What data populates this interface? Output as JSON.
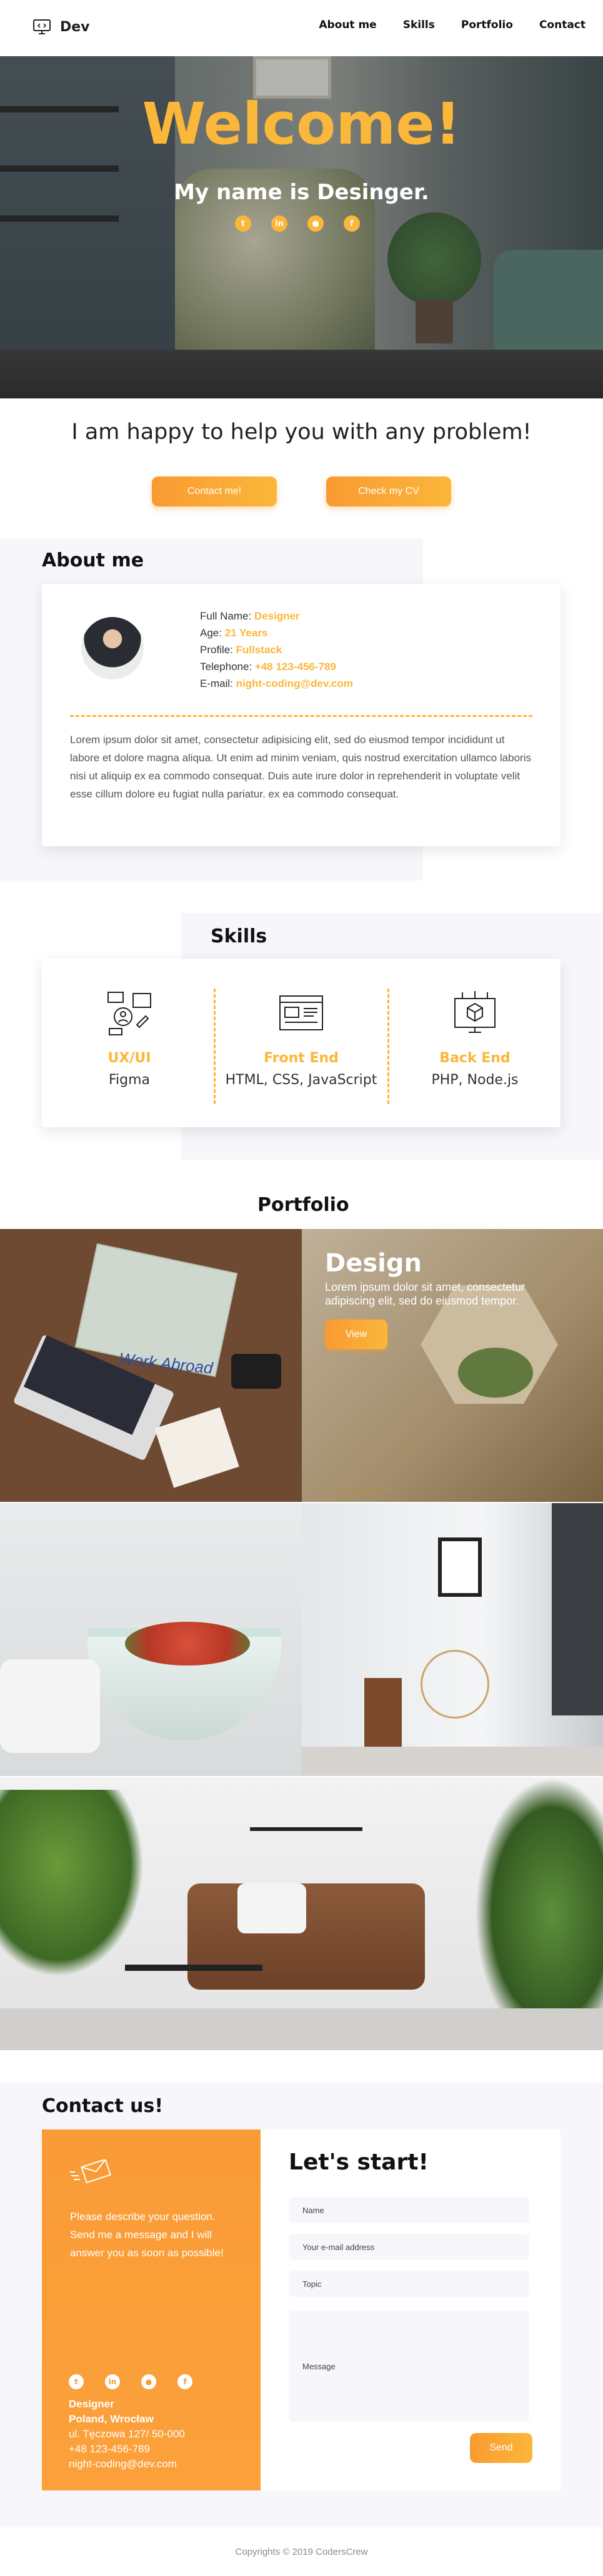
{
  "nav": {
    "logo_text": "Dev",
    "items": [
      "About me",
      "Skills",
      "Portfolio",
      "Contact"
    ]
  },
  "hero": {
    "title": "Welcome!",
    "subtitle": "My name is Desinger."
  },
  "social_icons": [
    "twitter-icon",
    "linkedin-icon",
    "github-icon",
    "facebook-icon"
  ],
  "tagline": "I am happy to help you with any problem!",
  "buttons": {
    "contact": "Contact me!",
    "cv": "Check my CV"
  },
  "about": {
    "title": "About me",
    "full_name_label": "Full Name: ",
    "full_name": "Designer",
    "age_label": "Age: ",
    "age": "21 Years",
    "profile_label": "Profile: ",
    "profile": "Fullstack",
    "telephone_label": "Telephone: ",
    "telephone": "+48 123-456-789",
    "email_label": "E-mail: ",
    "email": "night-coding@dev.com",
    "bio": "Lorem ipsum dolor sit amet, consectetur adipisicing elit, sed do eiusmod tempor incididunt ut labore et dolore magna aliqua. Ut enim ad minim veniam, quis nostrud exercitation ullamco laboris nisi ut aliquip ex ea commodo consequat. Duis aute irure dolor in reprehenderit in voluptate velit esse cillum dolore eu fugiat nulla pariatur. ex ea commodo consequat."
  },
  "skills": {
    "title": "Skills",
    "items": [
      {
        "name": "UX/UI",
        "desc": "Figma"
      },
      {
        "name": "Front End",
        "desc": "HTML, CSS, JavaScript"
      },
      {
        "name": "Back End",
        "desc": "PHP, Node.js"
      }
    ]
  },
  "portfolio": {
    "title": "Portfolio",
    "map_caption": "Work Abroad",
    "overlay_title": "Design",
    "overlay_text": "Lorem ipsum dolor sit amet, consectetur adipiscing elit, sed do eiusmod tempor.",
    "overlay_button": "View"
  },
  "contact": {
    "title": "Contact us!",
    "left_text": "Please describe your question. Send me a message and I will answer you as soon as possible!",
    "name": "Designer",
    "city": "Poland, Wrocław",
    "street": "ul. Tęczowa 127/ 50-000",
    "phone": "+48 123-456-789",
    "email": "night-coding@dev.com",
    "form_title": "Let's start!",
    "name_placeholder": "Name",
    "email_placeholder": "Your e-mail address",
    "topic_placeholder": "Topic",
    "message_placeholder": "Message",
    "send": "Send"
  },
  "footer": "Copyrights © 2019 CodersCrew",
  "accent_color": "#fbb73a"
}
